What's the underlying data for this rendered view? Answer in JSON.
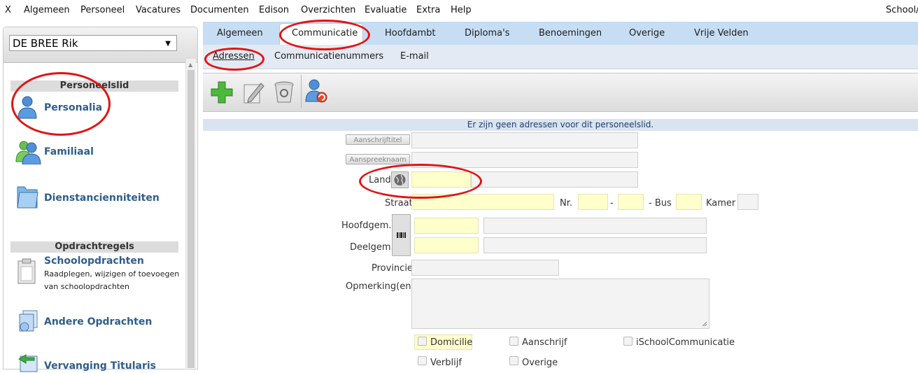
{
  "menu": {
    "items": [
      "X",
      "Algemeen",
      "Personeel",
      "Vacatures",
      "Documenten",
      "Edison",
      "Overzichten",
      "Evaluatie",
      "Extra",
      "Help"
    ],
    "app_title": "School/"
  },
  "left": {
    "selected_person": "DE BREE Rik",
    "section_personeelslid": "Personeelslid",
    "personalia": "Personalia",
    "familiaal": "Familiaal",
    "dienstancienniteiten": "Dienstancienniteiten",
    "section_opdrachtregels": "Opdrachtregels",
    "schoolopdrachten": "Schoolopdrachten",
    "schoolopdrachten_desc_1": "Raadplegen, wijzigen of toevoegen",
    "schoolopdrachten_desc_2": "van schoolopdrachten",
    "andere_opdrachten": "Andere Opdrachten",
    "vervanging_titularis": "Vervanging Titularis"
  },
  "tabs": {
    "items": [
      "Algemeen",
      "Communicatie",
      "Hoofdambt",
      "Diploma's",
      "Benoemingen",
      "Overige",
      "Vrije Velden"
    ],
    "active": "Communicatie"
  },
  "subtabs": {
    "items": [
      "Adressen",
      "Communicatienummers",
      "E-mail"
    ],
    "active": "Adressen"
  },
  "message": "Er zijn geen adressen voor dit personeelslid.",
  "form": {
    "aanschrijftitel_btn": "Aanschrijftitel",
    "aanspreeknaam_btn": "Aanspreeknaam",
    "land": "Land",
    "straat": "Straat",
    "nr": "Nr.",
    "dash": "-",
    "bus": "- Bus",
    "kamer": "Kamer",
    "hoofdgem": "Hoofdgem.",
    "deelgem": "Deelgem.",
    "provincie": "Provincie",
    "opmerking": "Opmerking(en)",
    "checkboxes": {
      "domicilie": "Domicilie",
      "aanschrijf": "Aanschrijf",
      "ischoolcommunicatie": "iSchoolCommunicatie",
      "verblijf": "Verblijf",
      "overige": "Overige"
    }
  },
  "colors": {
    "tab_bar": "#c6ddf3",
    "required_field": "#ffffcc",
    "link_blue": "#2f5d8c",
    "annotation_red": "#e11414"
  }
}
